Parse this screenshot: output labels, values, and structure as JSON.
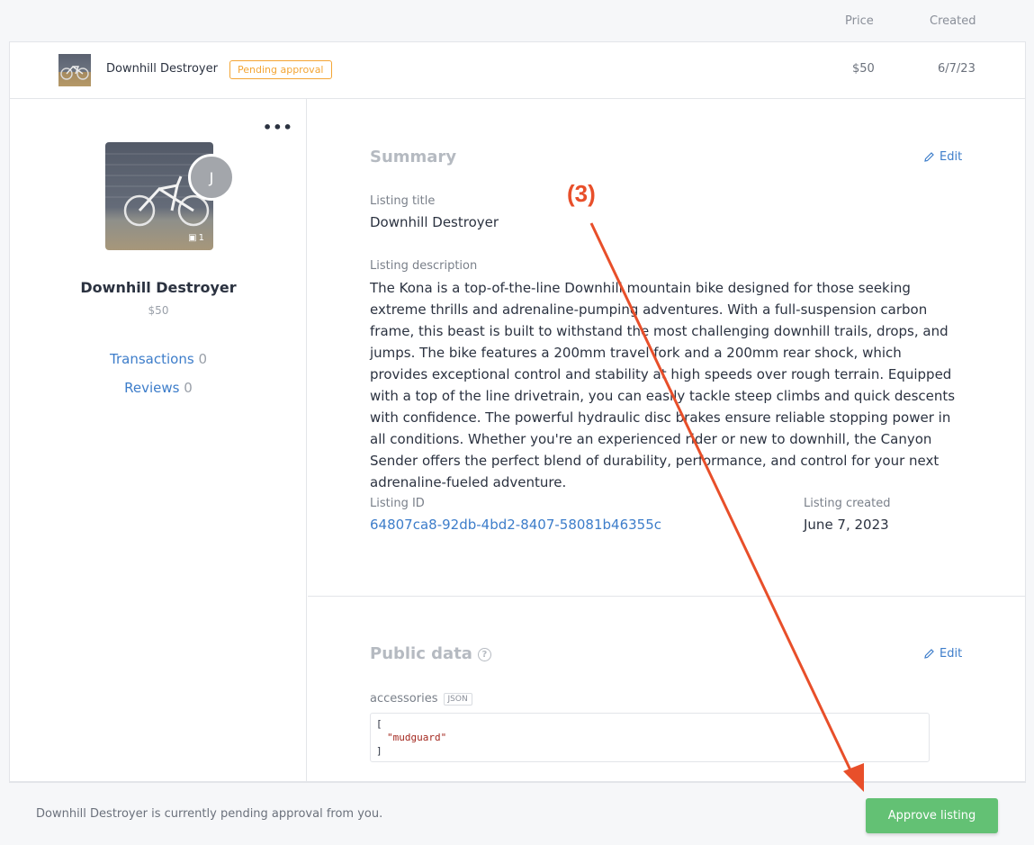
{
  "table": {
    "columns": {
      "price": "Price",
      "created": "Created"
    },
    "row": {
      "title": "Downhill Destroyer",
      "status": "Pending approval",
      "price": "$50",
      "created": "6/7/23"
    }
  },
  "sidebar": {
    "menu_icon": "more-dots-icon",
    "avatar_initial": "J",
    "image_count": "1",
    "title": "Downhill Destroyer",
    "price": "$50",
    "links": [
      {
        "label": "Transactions",
        "count": "0"
      },
      {
        "label": "Reviews",
        "count": "0"
      }
    ]
  },
  "summary": {
    "heading": "Summary",
    "edit_label": "Edit",
    "title_label": "Listing title",
    "title_value": "Downhill Destroyer",
    "description_label": "Listing description",
    "description_value": "The Kona is a top-of-the-line Downhill mountain bike designed for those seeking extreme thrills and adrenaline-pumping adventures. With a full-suspension carbon frame, this beast is built to withstand the most challenging downhill trails, drops, and jumps. The bike features a 200mm travel fork and a 200mm rear shock, which provides exceptional control and stability at high speeds over rough terrain. Equipped with a top of the line drivetrain, you can easily tackle steep climbs and quick descents with confidence. The powerful hydraulic disc brakes ensure reliable stopping power in all conditions. Whether you're an experienced rider or new to downhill, the Canyon Sender offers the perfect blend of durability, performance, and control for your next adrenaline-fueled adventure.",
    "id_label": "Listing ID",
    "id_value": "64807ca8-92db-4bd2-8407-58081b46355c",
    "created_label": "Listing created",
    "created_value": "June 7, 2023"
  },
  "public_data": {
    "heading": "Public data",
    "help_icon": "?",
    "edit_label": "Edit",
    "field_label": "accessories",
    "field_type": "JSON",
    "json_open": "[",
    "json_item": "\"mudguard\"",
    "json_close": "]"
  },
  "footer": {
    "message": "Downhill Destroyer is currently pending approval from you.",
    "approve_label": "Approve listing"
  },
  "annotation": {
    "label": "(3)",
    "color": "#e84f2a"
  },
  "colors": {
    "accent": "#3d7dca",
    "pending": "#f3a534",
    "approve": "#63c174"
  }
}
